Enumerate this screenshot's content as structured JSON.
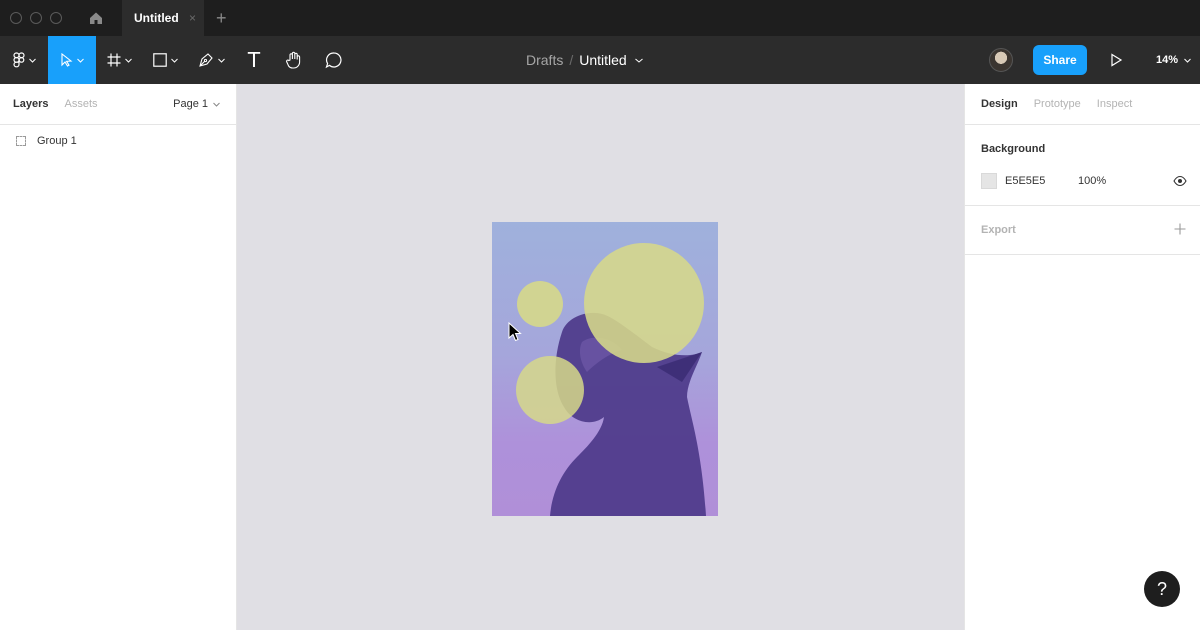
{
  "titlebar": {
    "tab_title": "Untitled",
    "tab_close": "×",
    "new_tab": "+"
  },
  "toolbar": {
    "breadcrumb_root": "Drafts",
    "breadcrumb_sep": "/",
    "file_name": "Untitled",
    "share_label": "Share",
    "zoom_level": "14%",
    "text_tool_glyph": "T"
  },
  "left_panel": {
    "tabs": [
      "Layers",
      "Assets"
    ],
    "page_selector": "Page 1",
    "layers": [
      {
        "name": "Group 1",
        "icon": "group-icon"
      }
    ]
  },
  "right_panel": {
    "tabs": [
      "Design",
      "Prototype",
      "Inspect"
    ],
    "background": {
      "title": "Background",
      "hex": "E5E5E5",
      "opacity": "100%",
      "color": "#e5e5e5"
    },
    "export": {
      "title": "Export"
    }
  },
  "help": {
    "label": "?"
  },
  "colors": {
    "accent": "#18a0fb",
    "toolbar_bg": "#2c2c2c",
    "titlebar_bg": "#1e1e1e",
    "canvas_bg": "#e0dfe4"
  }
}
